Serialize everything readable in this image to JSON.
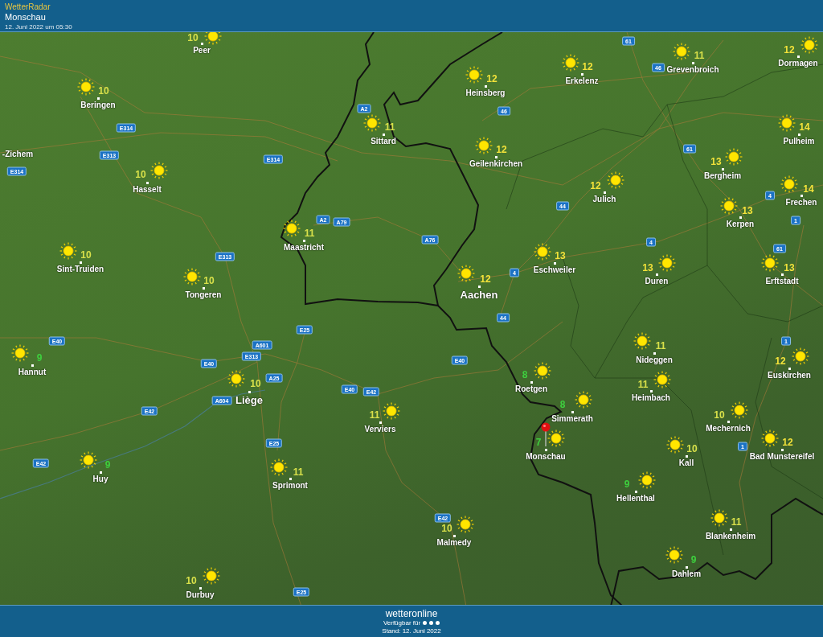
{
  "header": {
    "app_name": "WetterRadar",
    "location": "Monschau",
    "timestamp": "12. Juni 2022 um 05:30"
  },
  "map": {
    "cities": [
      {
        "name": "Peer",
        "temp": "10",
        "color": "#d8e04a",
        "kind": "town"
      },
      {
        "name": "Beringen",
        "temp": "10",
        "color": "#d8e04a",
        "kind": "town"
      },
      {
        "name": "Hasselt",
        "temp": "10",
        "color": "#d8e04a",
        "kind": "town"
      },
      {
        "name": "Sint-Truiden",
        "temp": "10",
        "color": "#d8e04a",
        "kind": "town"
      },
      {
        "name": "Tongeren",
        "temp": "10",
        "color": "#d8e04a",
        "kind": "town"
      },
      {
        "name": "Maastricht",
        "temp": "11",
        "color": "#d8e04a",
        "kind": "town"
      },
      {
        "name": "Sittard",
        "temp": "11",
        "color": "#d8e04a",
        "kind": "town"
      },
      {
        "name": "Heinsberg",
        "temp": "12",
        "color": "#f2e23a",
        "kind": "town"
      },
      {
        "name": "Erkelenz",
        "temp": "12",
        "color": "#f2e23a",
        "kind": "town"
      },
      {
        "name": "Grevenbroich",
        "temp": "11",
        "color": "#d8e04a",
        "kind": "town"
      },
      {
        "name": "Dormagen",
        "temp": "12",
        "color": "#f2e23a",
        "kind": "town"
      },
      {
        "name": "Geilenkirchen",
        "temp": "12",
        "color": "#f2e23a",
        "kind": "town"
      },
      {
        "name": "Julich",
        "temp": "12",
        "color": "#f2e23a",
        "kind": "town"
      },
      {
        "name": "Pulheim",
        "temp": "14",
        "color": "#f2e23a",
        "kind": "town"
      },
      {
        "name": "Bergheim",
        "temp": "13",
        "color": "#f2e23a",
        "kind": "town"
      },
      {
        "name": "Frechen",
        "temp": "14",
        "color": "#f2e23a",
        "kind": "town"
      },
      {
        "name": "Kerpen",
        "temp": "13",
        "color": "#f2e23a",
        "kind": "town"
      },
      {
        "name": "Eschweiler",
        "temp": "13",
        "color": "#f2e23a",
        "kind": "town"
      },
      {
        "name": "Duren",
        "temp": "13",
        "color": "#f2e23a",
        "kind": "town"
      },
      {
        "name": "Erftstadt",
        "temp": "13",
        "color": "#f2e23a",
        "kind": "town"
      },
      {
        "name": "Aachen",
        "temp": "12",
        "color": "#f2e23a",
        "kind": "major"
      },
      {
        "name": "Hannut",
        "temp": "9",
        "color": "#3ecf3e",
        "kind": "town"
      },
      {
        "name": "Liège",
        "temp": "10",
        "color": "#d8e04a",
        "kind": "major"
      },
      {
        "name": "Verviers",
        "temp": "11",
        "color": "#d8e04a",
        "kind": "town"
      },
      {
        "name": "Huy",
        "temp": "9",
        "color": "#3ecf3e",
        "kind": "town"
      },
      {
        "name": "Sprimont",
        "temp": "11",
        "color": "#d8e04a",
        "kind": "town"
      },
      {
        "name": "Roetgen",
        "temp": "8",
        "color": "#3ecf3e",
        "kind": "town"
      },
      {
        "name": "Simmerath",
        "temp": "8",
        "color": "#3ecf3e",
        "kind": "town"
      },
      {
        "name": "Monschau",
        "temp": "7",
        "color": "#3ecf3e",
        "kind": "town"
      },
      {
        "name": "Nideggen",
        "temp": "11",
        "color": "#d8e04a",
        "kind": "town"
      },
      {
        "name": "Heimbach",
        "temp": "11",
        "color": "#d8e04a",
        "kind": "town"
      },
      {
        "name": "Euskirchen",
        "temp": "12",
        "color": "#f2e23a",
        "kind": "town"
      },
      {
        "name": "Mechernich",
        "temp": "10",
        "color": "#d8e04a",
        "kind": "town"
      },
      {
        "name": "Bad Munstereifel",
        "temp": "12",
        "color": "#f2e23a",
        "kind": "town"
      },
      {
        "name": "Kall",
        "temp": "10",
        "color": "#d8e04a",
        "kind": "town"
      },
      {
        "name": "Hellenthal",
        "temp": "9",
        "color": "#3ecf3e",
        "kind": "town"
      },
      {
        "name": "Blankenheim",
        "temp": "11",
        "color": "#d8e04a",
        "kind": "town"
      },
      {
        "name": "Malmedy",
        "temp": "10",
        "color": "#d8e04a",
        "kind": "town"
      },
      {
        "name": "Dahlem",
        "temp": "9",
        "color": "#3ecf3e",
        "kind": "town"
      },
      {
        "name": "Durbuy",
        "temp": "10",
        "color": "#d8e04a",
        "kind": "town"
      }
    ],
    "place_labels": [
      "-Zichem"
    ],
    "road_signs": [
      "E314",
      "E313",
      "E314",
      "E314",
      "A2",
      "A2",
      "A79",
      "A76",
      "E313",
      "61",
      "46",
      "46",
      "61",
      "44",
      "4",
      "1",
      "61",
      "4",
      "4",
      "44",
      "E25",
      "A601",
      "E313",
      "E40",
      "E40",
      "A25",
      "E40",
      "E42",
      "A604",
      "E42",
      "E25",
      "E42",
      "E40",
      "E42",
      "E25",
      "1",
      "1"
    ]
  },
  "footer": {
    "logo": "wetteronline",
    "availability": "Verfügbar für",
    "updated": "Stand: 12. Juni 2022"
  }
}
